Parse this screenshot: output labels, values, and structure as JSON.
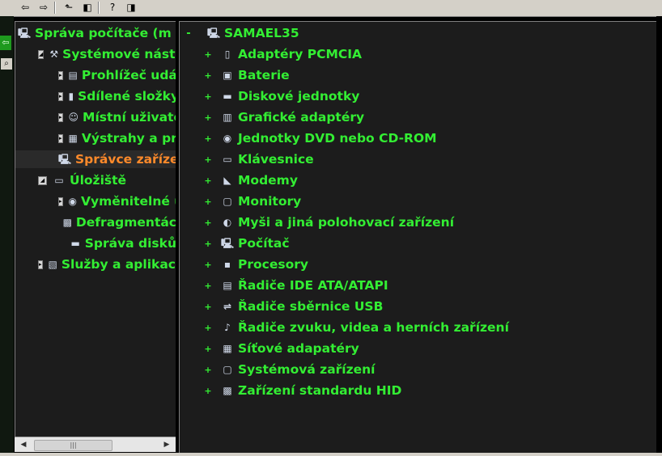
{
  "toolbar": {
    "buttons": [
      {
        "name": "back-button",
        "glyph": "⇦"
      },
      {
        "name": "forward-button",
        "glyph": "⇨"
      },
      {
        "name": "up-one-level-button",
        "glyph": "⬑"
      },
      {
        "name": "show-hide-tree-button",
        "glyph": "◧"
      },
      {
        "name": "properties-button",
        "glyph": "?"
      },
      {
        "name": "help-button",
        "glyph": "◨"
      }
    ]
  },
  "colors": {
    "text": "#33ee33",
    "selected_text": "#ff8a2a",
    "pane_bg": "#1c1c1c"
  },
  "tree": [
    {
      "label": "Správa počítače (m",
      "icon": "computer-icon",
      "expander": "",
      "level": 0,
      "selected": false
    },
    {
      "label": "Systémové nástr",
      "icon": "system-tools-icon",
      "expander": "minus",
      "level": 1,
      "selected": false
    },
    {
      "label": "Prohlížeč udál",
      "icon": "event-viewer-icon",
      "expander": "plus",
      "level": 2,
      "selected": false
    },
    {
      "label": "Sdílené složky",
      "icon": "shared-folders-icon",
      "expander": "plus",
      "level": 2,
      "selected": false
    },
    {
      "label": "Místní uživate",
      "icon": "local-users-icon",
      "expander": "plus",
      "level": 2,
      "selected": false
    },
    {
      "label": "Výstrahy a pro",
      "icon": "alerts-icon",
      "expander": "plus",
      "level": 2,
      "selected": false
    },
    {
      "label": "Správce zaříze",
      "icon": "device-manager-icon",
      "expander": "",
      "level": 2,
      "selected": true
    },
    {
      "label": "Úložiště",
      "icon": "storage-icon",
      "expander": "minus",
      "level": 1,
      "selected": false
    },
    {
      "label": "Vyměnitelné ú",
      "icon": "removable-storage-icon",
      "expander": "plus",
      "level": 2,
      "selected": false
    },
    {
      "label": "Defragmentác",
      "icon": "defrag-icon",
      "expander": "",
      "level": 2,
      "selected": false
    },
    {
      "label": "Správa disků",
      "icon": "disk-management-icon",
      "expander": "",
      "level": 2,
      "selected": false
    },
    {
      "label": "Služby a aplikace",
      "icon": "services-icon",
      "expander": "plus",
      "level": 1,
      "selected": false
    }
  ],
  "hscroll": {
    "left": "◀",
    "right": "▶",
    "thumb": "|||"
  },
  "device_root": {
    "label": "SAMAEL35",
    "expander": "-",
    "icon": "computer-icon"
  },
  "devices": [
    {
      "label": "Adaptéry PCMCIA",
      "icon": "pcmcia-icon"
    },
    {
      "label": "Baterie",
      "icon": "battery-icon"
    },
    {
      "label": "Diskové jednotky",
      "icon": "disk-drive-icon"
    },
    {
      "label": "Grafické adaptéry",
      "icon": "display-adapter-icon"
    },
    {
      "label": "Jednotky DVD nebo CD-ROM",
      "icon": "cdrom-icon"
    },
    {
      "label": "Klávesnice",
      "icon": "keyboard-icon"
    },
    {
      "label": "Modemy",
      "icon": "modem-icon"
    },
    {
      "label": "Monitory",
      "icon": "monitor-icon"
    },
    {
      "label": "Myši a jiná polohovací zařízení",
      "icon": "mouse-icon"
    },
    {
      "label": "Počítač",
      "icon": "computer-icon"
    },
    {
      "label": "Procesory",
      "icon": "processor-icon"
    },
    {
      "label": "Řadiče IDE ATA/ATAPI",
      "icon": "ide-controller-icon"
    },
    {
      "label": "Řadiče sběrnice USB",
      "icon": "usb-icon"
    },
    {
      "label": "Řadiče zvuku, videa a herních zařízení",
      "icon": "sound-icon"
    },
    {
      "label": "Síťové adapatéry",
      "icon": "network-adapter-icon"
    },
    {
      "label": "Systémová zařízení",
      "icon": "system-device-icon"
    },
    {
      "label": "Zařízení standardu HID",
      "icon": "hid-icon"
    }
  ],
  "device_expander": "+"
}
